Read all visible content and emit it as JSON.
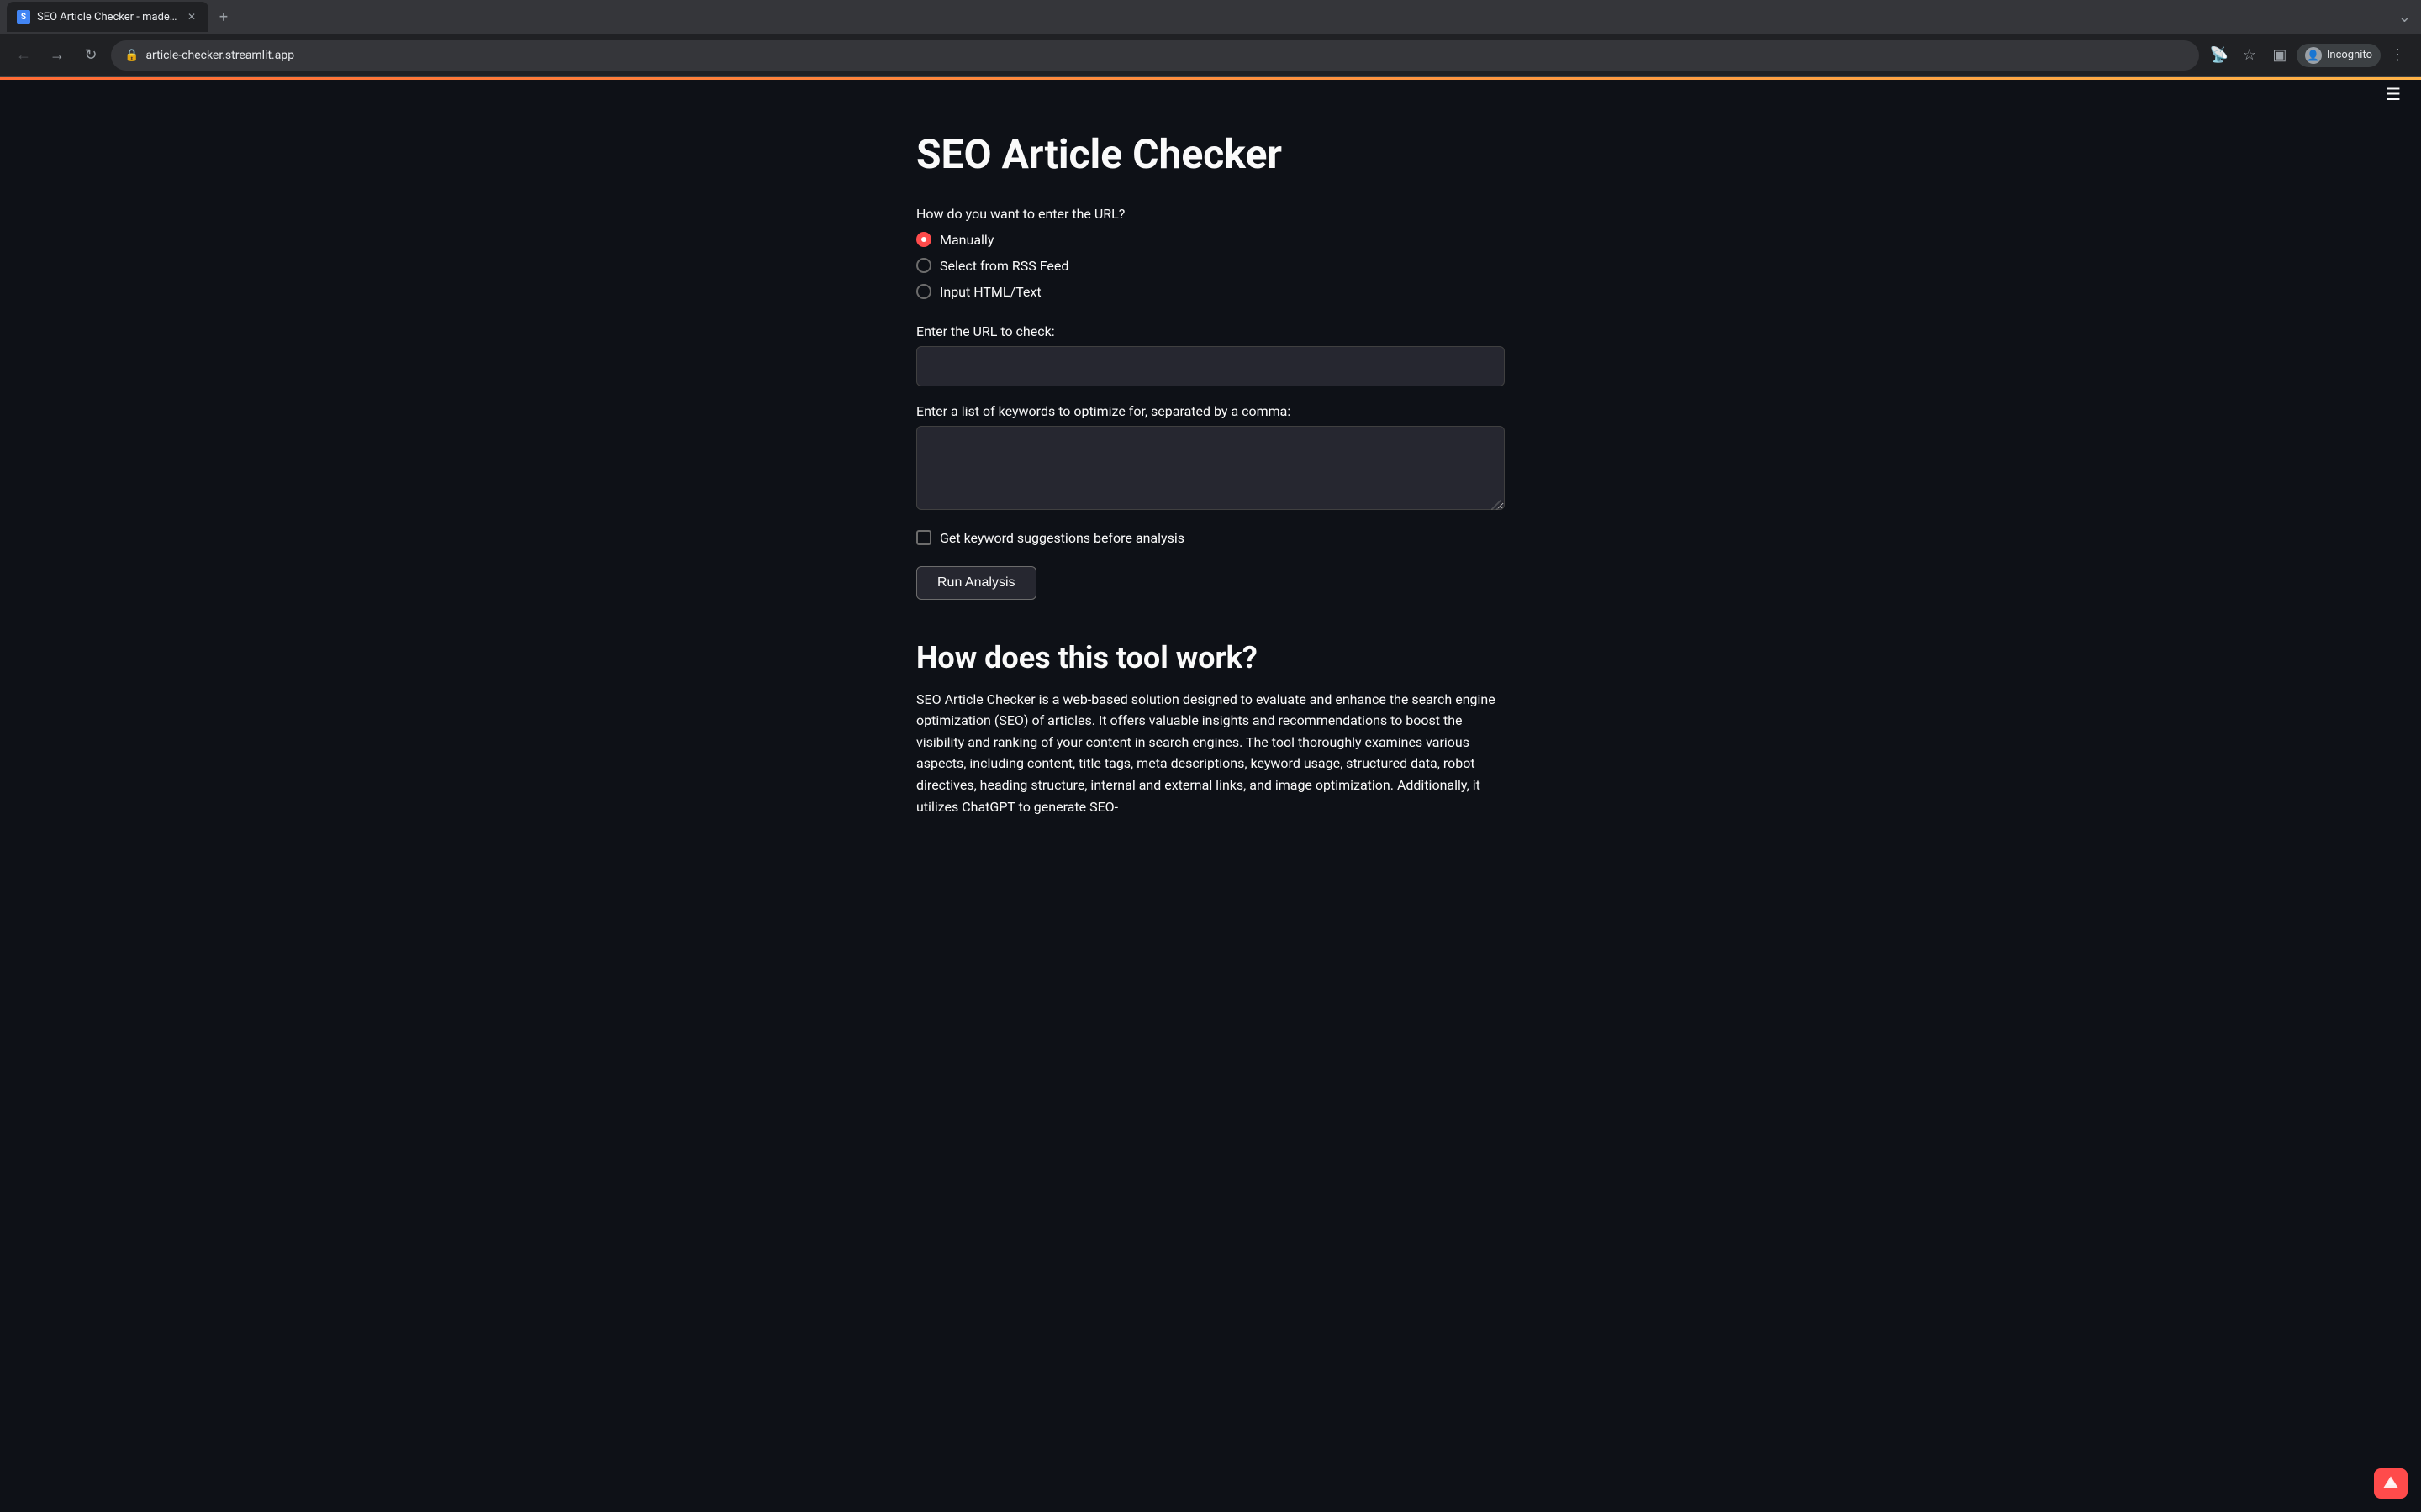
{
  "browser": {
    "tab_title": "SEO Article Checker - made b",
    "url": "article-checker.streamlit.app",
    "incognito_label": "Incognito"
  },
  "hamburger_menu": "≡",
  "page": {
    "title": "SEO Article Checker",
    "url_method_label": "How do you want to enter the URL?",
    "radio_options": [
      {
        "id": "manually",
        "label": "Manually",
        "checked": true
      },
      {
        "id": "rss",
        "label": "Select from RSS Feed",
        "checked": false
      },
      {
        "id": "html",
        "label": "Input HTML/Text",
        "checked": false
      }
    ],
    "url_input_label": "Enter the URL to check:",
    "url_input_placeholder": "",
    "keywords_label": "Enter a list of keywords to optimize for, separated by a comma:",
    "keywords_placeholder": "",
    "checkbox_label": "Get keyword suggestions before analysis",
    "run_button_label": "Run Analysis",
    "how_title": "How does this tool work?",
    "how_description": "SEO Article Checker is a web-based solution designed to evaluate and enhance the search engine optimization (SEO) of articles. It offers valuable insights and recommendations to boost the visibility and ranking of your content in search engines. The tool thoroughly examines various aspects, including content, title tags, meta descriptions, keyword usage, structured data, robot directives, heading structure, internal and external links, and image optimization. Additionally, it utilizes ChatGPT to generate SEO-"
  }
}
